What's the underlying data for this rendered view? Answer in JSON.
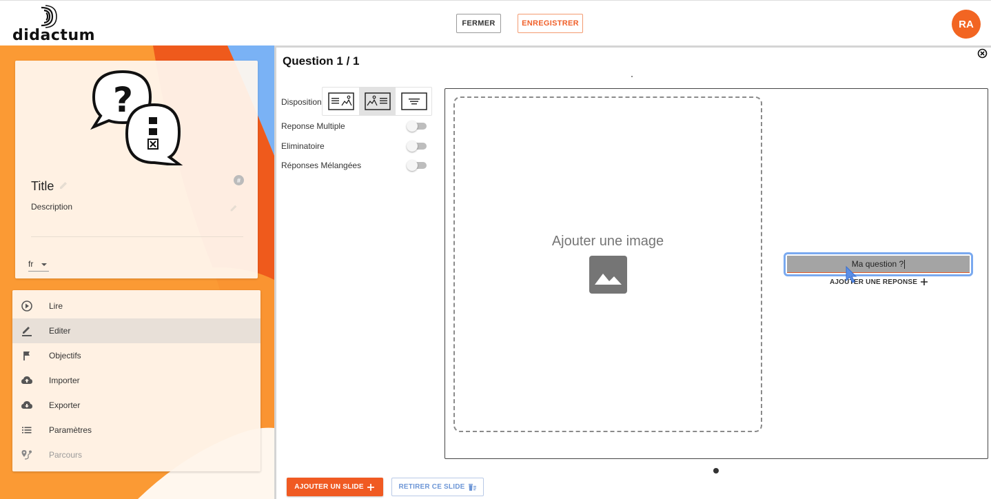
{
  "header": {
    "logo_text": "didactum",
    "close_label": "FERMER",
    "save_label": "ENREGISTRER",
    "avatar_initials": "RA"
  },
  "card": {
    "title": "Title",
    "description_label": "Description",
    "hash_badge": "#",
    "language": "fr"
  },
  "menu": {
    "items": [
      {
        "label": "Lire",
        "icon": "play-circle-icon"
      },
      {
        "label": "Editer",
        "icon": "pencil-icon",
        "active": true
      },
      {
        "label": "Objectifs",
        "icon": "flag-icon"
      },
      {
        "label": "Importer",
        "icon": "cloud-upload-icon"
      },
      {
        "label": "Exporter",
        "icon": "cloud-download-icon"
      },
      {
        "label": "Paramètres",
        "icon": "list-icon"
      },
      {
        "label": "Parcours",
        "icon": "route-pin-icon",
        "disabled": true
      }
    ]
  },
  "editor": {
    "question_title": "Question 1 / 1",
    "disposition_label": "Disposition",
    "layout_options": [
      "text-image-layout-icon",
      "image-text-layout-icon",
      "text-only-layout-icon"
    ],
    "selected_layout": 1,
    "options": [
      {
        "label": "Reponse Multiple",
        "enabled": false
      },
      {
        "label": "Eliminatoire",
        "enabled": false
      },
      {
        "label": "Réponses Mélangées",
        "enabled": false
      }
    ],
    "add_image_label": "Ajouter une image",
    "question_value": "Ma question ?",
    "add_answer_label": "AJOUTER UNE REPONSE",
    "add_slide_label": "AJOUTER UN SLIDE",
    "remove_slide_label": "RETIRER CE SLIDE"
  },
  "colors": {
    "brand_orange": "#f26522",
    "accent_blue": "#7aa9ef",
    "menu_active": "#e8e0d8"
  }
}
